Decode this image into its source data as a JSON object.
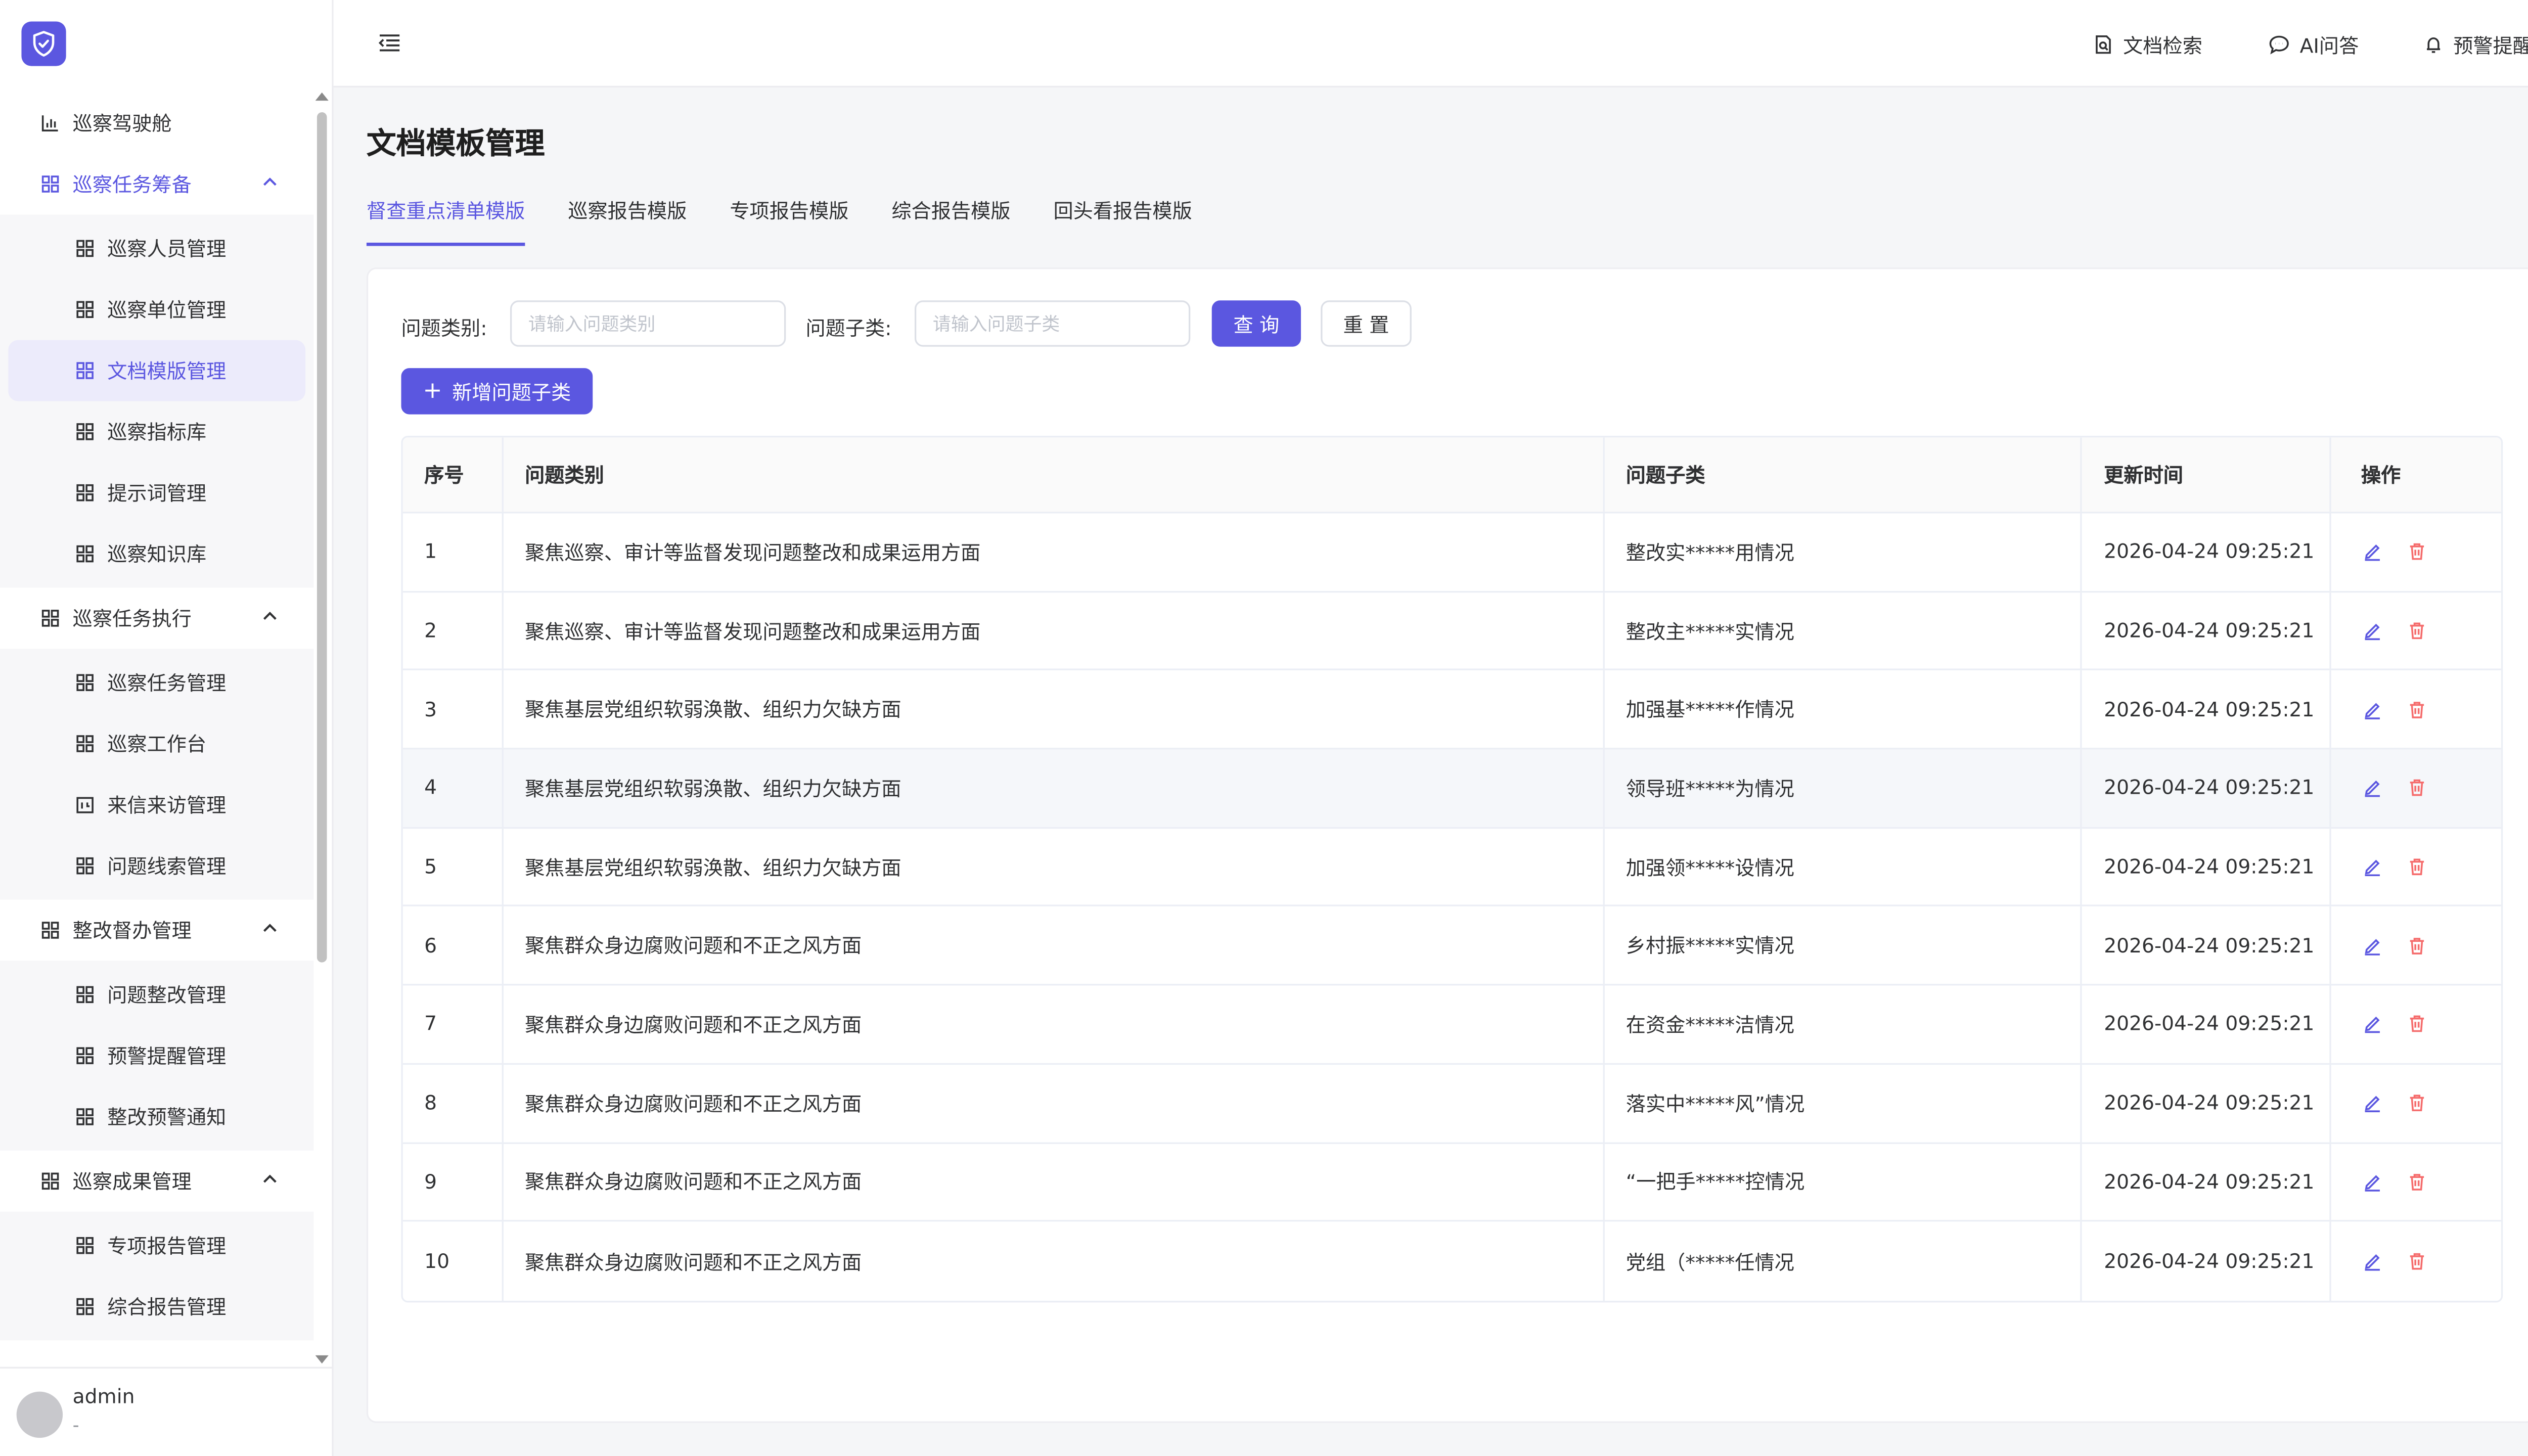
{
  "colors": {
    "accent": "#5b57e0",
    "danger": "#f56c6c",
    "active_bg": "#ecebfb"
  },
  "sidebar": {
    "logo_icon": "shield-check-icon",
    "menu": [
      {
        "label": "巡察驾驶舱",
        "icon": "bar-chart-icon"
      },
      {
        "label": "巡察任务筹备",
        "icon": "grid-icon",
        "expanded": true,
        "children": [
          {
            "label": "巡察人员管理"
          },
          {
            "label": "巡察单位管理"
          },
          {
            "label": "文档模版管理",
            "active": true
          },
          {
            "label": "巡察指标库"
          },
          {
            "label": "提示词管理"
          },
          {
            "label": "巡察知识库"
          }
        ]
      },
      {
        "label": "巡察任务执行",
        "icon": "grid-icon",
        "expanded": true,
        "children": [
          {
            "label": "巡察任务管理"
          },
          {
            "label": "巡察工作台"
          },
          {
            "label": "来信来访管理",
            "icon": "calendar-icon"
          },
          {
            "label": "问题线索管理"
          }
        ]
      },
      {
        "label": "整改督办管理",
        "icon": "grid-icon",
        "expanded": true,
        "children": [
          {
            "label": "问题整改管理"
          },
          {
            "label": "预警提醒管理"
          },
          {
            "label": "整改预警通知"
          }
        ]
      },
      {
        "label": "巡察成果管理",
        "icon": "grid-icon",
        "expanded": true,
        "children": [
          {
            "label": "专项报告管理"
          },
          {
            "label": "综合报告管理"
          }
        ]
      }
    ],
    "user": {
      "name": "admin",
      "role": "-"
    }
  },
  "header": {
    "doc_search": "文档检索",
    "ai_qa": "AI问答",
    "warning": "预警提醒"
  },
  "page": {
    "title": "文档模板管理",
    "tabs": [
      "督查重点清单模版",
      "巡察报告模版",
      "专项报告模版",
      "综合报告模版",
      "回头看报告模版"
    ],
    "active_tab": 0
  },
  "filter": {
    "category_label": "问题类别:",
    "category_placeholder": "请输入问题类别",
    "subcategory_label": "问题子类:",
    "subcategory_placeholder": "请输入问题子类",
    "query_btn": "查 询",
    "reset_btn": "重 置",
    "add_btn": "新增问题子类"
  },
  "table": {
    "headers": [
      "序号",
      "问题类别",
      "问题子类",
      "更新时间",
      "操作"
    ],
    "rows": [
      {
        "idx": "1",
        "category": "聚焦巡察、审计等监督发现问题整改和成果运用方面",
        "sub": "整改实*****用情况",
        "time": "2026-04-24 09:25:21"
      },
      {
        "idx": "2",
        "category": "聚焦巡察、审计等监督发现问题整改和成果运用方面",
        "sub": "整改主*****实情况",
        "time": "2026-04-24 09:25:21"
      },
      {
        "idx": "3",
        "category": "聚焦基层党组织软弱涣散、组织力欠缺方面",
        "sub": "加强基*****作情况",
        "time": "2026-04-24 09:25:21"
      },
      {
        "idx": "4",
        "category": "聚焦基层党组织软弱涣散、组织力欠缺方面",
        "sub": "领导班*****为情况",
        "time": "2026-04-24 09:25:21"
      },
      {
        "idx": "5",
        "category": "聚焦基层党组织软弱涣散、组织力欠缺方面",
        "sub": "加强领*****设情况",
        "time": "2026-04-24 09:25:21"
      },
      {
        "idx": "6",
        "category": "聚焦群众身边腐败问题和不正之风方面",
        "sub": "乡村振*****实情况",
        "time": "2026-04-24 09:25:21"
      },
      {
        "idx": "7",
        "category": "聚焦群众身边腐败问题和不正之风方面",
        "sub": "在资金*****洁情况",
        "time": "2026-04-24 09:25:21"
      },
      {
        "idx": "8",
        "category": "聚焦群众身边腐败问题和不正之风方面",
        "sub": "落实中*****风”情况",
        "time": "2026-04-24 09:25:21"
      },
      {
        "idx": "9",
        "category": "聚焦群众身边腐败问题和不正之风方面",
        "sub": "“一把手*****控情况",
        "time": "2026-04-24 09:25:21"
      },
      {
        "idx": "10",
        "category": "聚焦群众身边腐败问题和不正之风方面",
        "sub": "党组（*****任情况",
        "time": "2026-04-24 09:25:21"
      }
    ],
    "edit_icon": "edit-icon",
    "delete_icon": "trash-icon"
  }
}
